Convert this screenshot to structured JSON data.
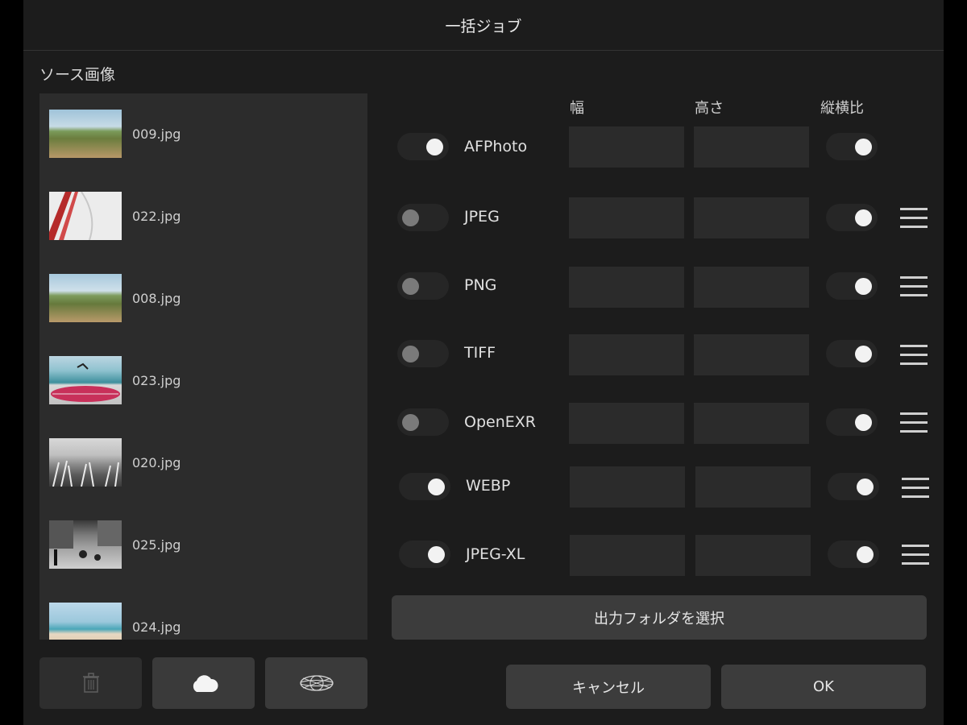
{
  "dialog": {
    "title": "一括ジョブ"
  },
  "source": {
    "label": "ソース画像",
    "items": [
      {
        "name": "009.jpg",
        "thumb": "vineyard-image"
      },
      {
        "name": "022.jpg",
        "thumb": "red-frame-image"
      },
      {
        "name": "008.jpg",
        "thumb": "vineyard-image"
      },
      {
        "name": "023.jpg",
        "thumb": "surfboard-image"
      },
      {
        "name": "020.jpg",
        "thumb": "bw-grass-image"
      },
      {
        "name": "025.jpg",
        "thumb": "bw-street-image"
      },
      {
        "name": "024.jpg",
        "thumb": "beach-image"
      }
    ]
  },
  "columns": {
    "width": "幅",
    "height": "高さ",
    "aspect": "縦横比"
  },
  "formats": [
    {
      "name": "AFPhoto",
      "enabled": true,
      "aspect_locked": true,
      "menu": false
    },
    {
      "name": "JPEG",
      "enabled": false,
      "aspect_locked": true,
      "menu": true
    },
    {
      "name": "PNG",
      "enabled": false,
      "aspect_locked": true,
      "menu": true
    },
    {
      "name": "TIFF",
      "enabled": false,
      "aspect_locked": true,
      "menu": true
    },
    {
      "name": "OpenEXR",
      "enabled": false,
      "aspect_locked": true,
      "menu": true
    },
    {
      "name": "WEBP",
      "enabled": true,
      "aspect_locked": true,
      "menu": true
    },
    {
      "name": "JPEG-XL",
      "enabled": true,
      "aspect_locked": true,
      "menu": true
    }
  ],
  "buttons": {
    "select_output": "出力フォルダを選択",
    "cancel": "キャンセル",
    "ok": "OK",
    "delete_icon": "trash-icon",
    "cloud_icon": "cloud-icon",
    "photos_icon": "photos-icon"
  },
  "colors": {
    "panel": "#1c1c1c",
    "field": "#2b2b2b",
    "button": "#3c3c3c",
    "knob_on": "#f2f2f2",
    "knob_off": "#7a7a7a"
  }
}
